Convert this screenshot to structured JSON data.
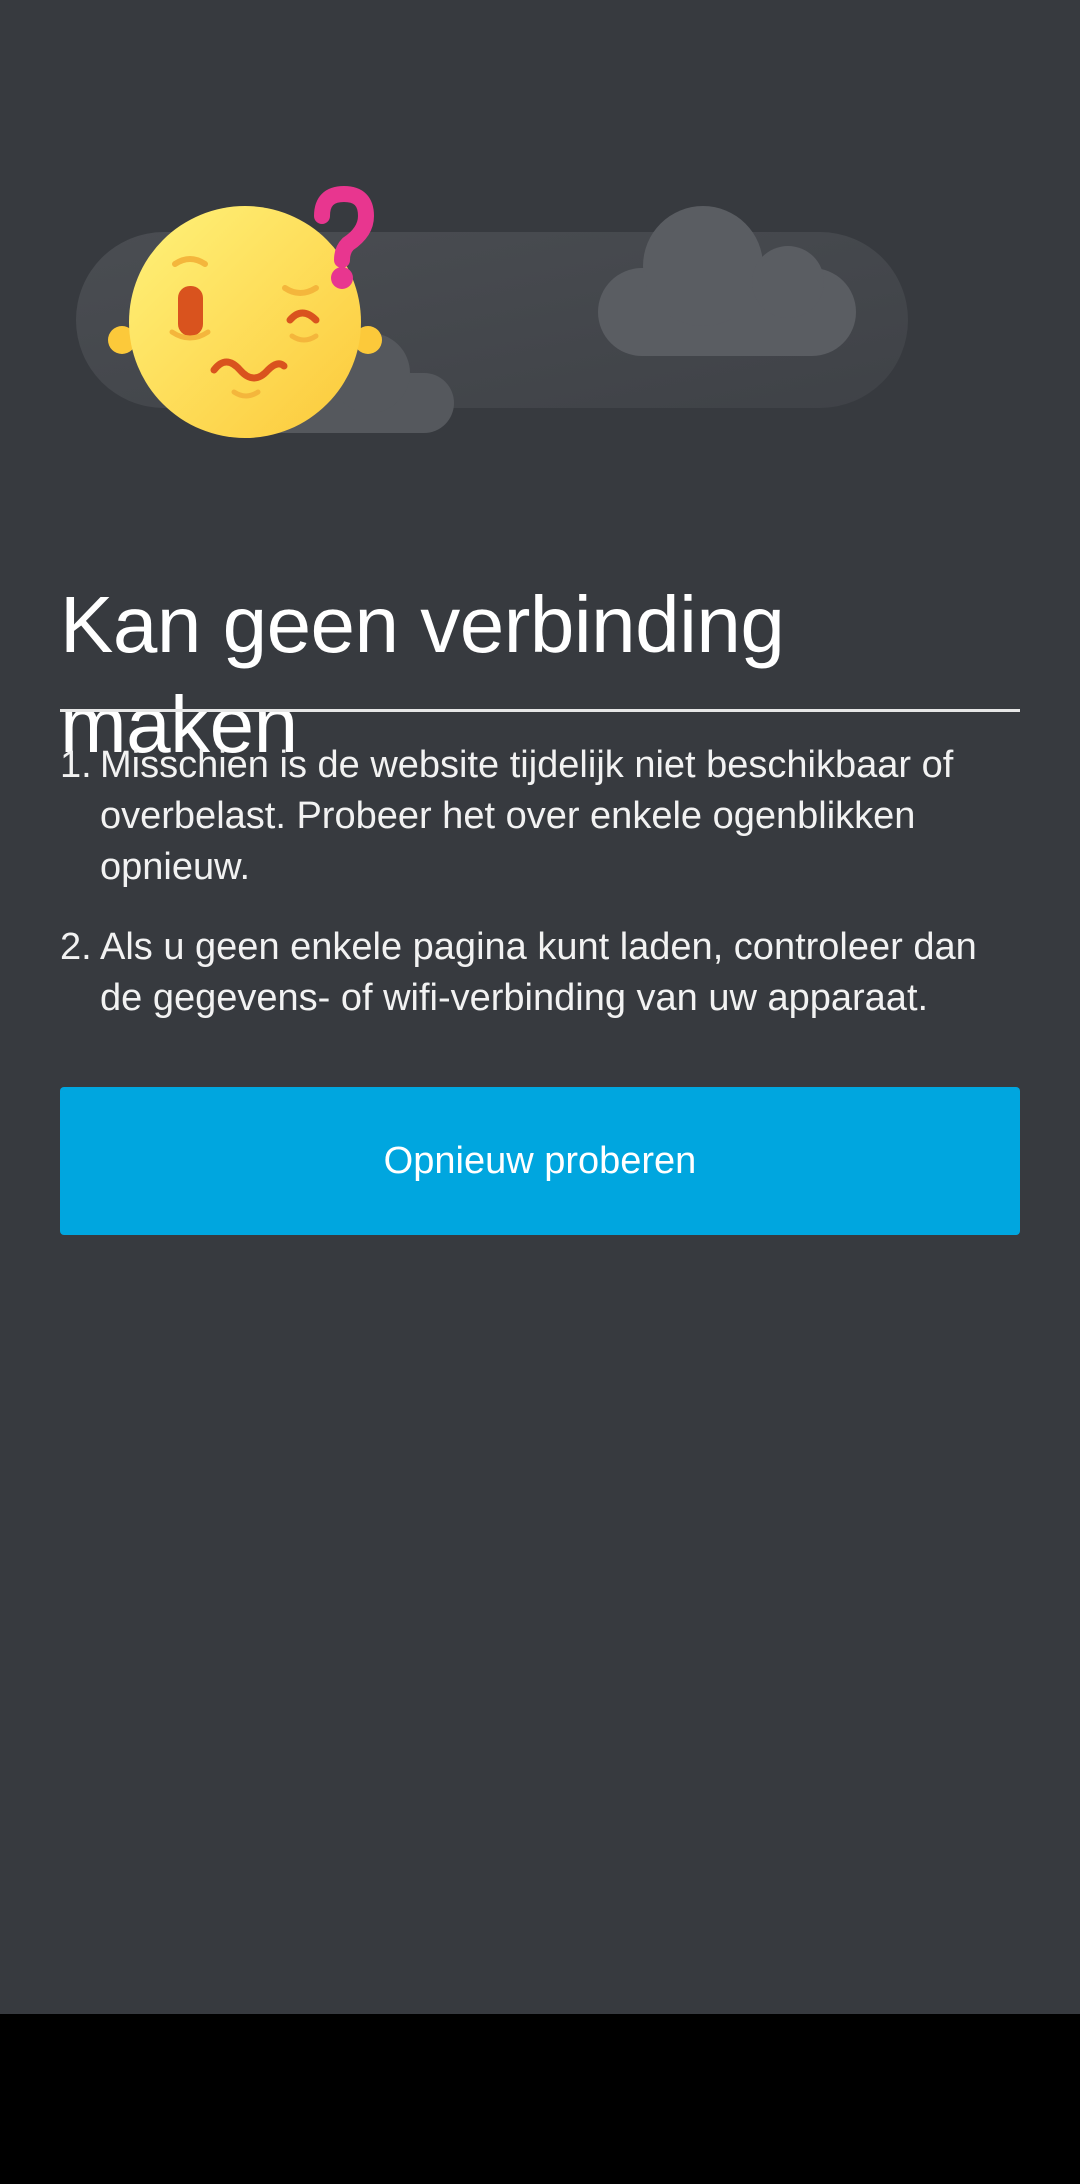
{
  "error_page": {
    "title": "Kan geen verbinding maken",
    "tips": [
      {
        "number": "1.",
        "text": "Misschien is de website tijdelijk niet beschikbaar of overbelast. Probeer het over enkele ogenblikken opnieuw."
      },
      {
        "number": "2.",
        "text": "Als u geen enkele pagina kunt laden, controleer dan de gegevens- of wifi-verbinding van uw apparaat."
      }
    ],
    "retry_button_label": "Opnieuw proberen",
    "illustration": {
      "icon": "confused-face-with-question-mark-icon",
      "background": "cloud-icons"
    }
  },
  "colors": {
    "background": "#373a3f",
    "accent_button": "#00a6df",
    "text": "#ffffff",
    "question_mark": "#e8368f",
    "face": "#fdd94f"
  }
}
